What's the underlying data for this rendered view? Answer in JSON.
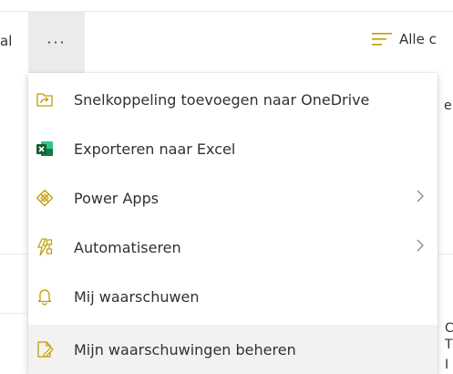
{
  "commandbar": {
    "left_cut_text": "al",
    "more_label": "···",
    "view_label": "Alle c"
  },
  "background": {
    "right_cut_1": "e",
    "right_cut_2": "C",
    "right_cut_3": "T",
    "right_cut_4": "I"
  },
  "menu": {
    "items": [
      {
        "label": "Snelkoppeling toevoegen naar OneDrive",
        "icon": "shortcut-icon"
      },
      {
        "label": "Exporteren naar Excel",
        "icon": "excel-icon"
      },
      {
        "label": "Power Apps",
        "icon": "power-apps-icon",
        "submenu": true
      },
      {
        "label": "Automatiseren",
        "icon": "automate-icon",
        "submenu": true
      },
      {
        "label": "Mij waarschuwen",
        "icon": "bell-icon"
      },
      {
        "label": "Mijn waarschuwingen beheren",
        "icon": "manage-alerts-icon"
      }
    ]
  },
  "colors": {
    "accent": "#c19c00",
    "excel_green": "#217346",
    "hover_bg": "#f3f2f1"
  }
}
